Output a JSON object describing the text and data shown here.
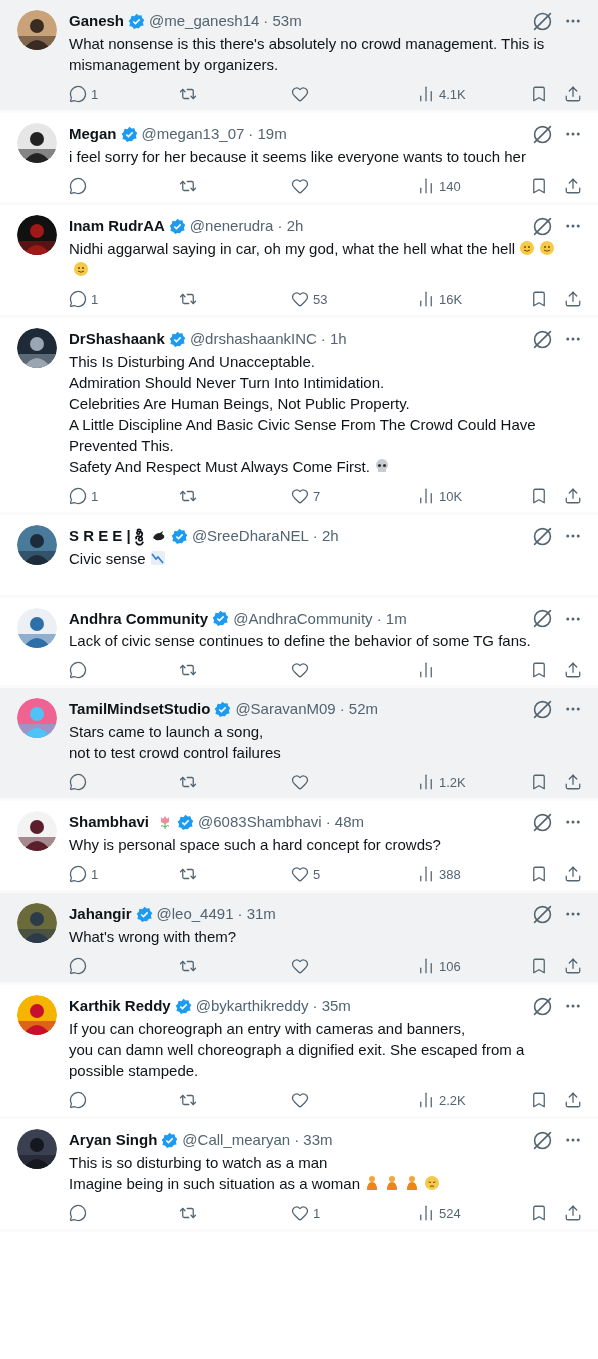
{
  "tweets": [
    {
      "name": "Ganesh",
      "handle": "@me_ganesh14",
      "time": "· 53m",
      "shaded": true,
      "text": "What nonsense is this there's absolutely no crowd management. This is mismanagement by organizers.",
      "actions": true,
      "replies": "1",
      "views": "4.1K"
    },
    {
      "name": "Megan",
      "handle": "@megan13_07",
      "time": "· 19m",
      "shaded": false,
      "text": "i feel sorry for her because it seems like everyone wants to touch her",
      "actions": true,
      "views": "140"
    },
    {
      "name": "Inam RudrAA",
      "handle": "@nenerudra",
      "time": "· 2h",
      "shaded": false,
      "text": "Nidhi aggarwal saying in car, oh my god, what the hell what the hell",
      "emojis": [
        {
          "kind": "smile"
        },
        {
          "kind": "smile"
        },
        {
          "kind": "smile"
        }
      ],
      "actions": true,
      "replies": "1",
      "likes": "53",
      "views": "16K"
    },
    {
      "name": "DrShashaank",
      "handle": "@drshashaankINC",
      "time": "· 1h",
      "shaded": false,
      "text": "This Is Disturbing And Unacceptable.\nAdmiration Should Never Turn Into Intimidation.\nCelebrities Are Human Beings, Not Public Property.\nA Little Discipline And Basic Civic Sense From The Crowd Could Have Prevented This.\nSafety And Respect Must Always Come First.",
      "emojis": [
        {
          "kind": "skull"
        }
      ],
      "actions": true,
      "replies": "1",
      "likes": "7",
      "views": "10K"
    },
    {
      "name": "S R E E | శ్రీ",
      "name_emojis": [
        {
          "kind": "bird"
        }
      ],
      "handle": "@SreeDharaNEL",
      "time": "· 2h",
      "shaded": false,
      "text": "Civic sense",
      "emojis": [
        {
          "kind": "chart-down"
        }
      ],
      "actions": false
    },
    {
      "name": "Andhra Community",
      "handle": "@AndhraCommunity",
      "time": "· 1m",
      "shaded": false,
      "text": "Lack of civic sense continues to define the behavior of some TG fans.",
      "actions": true
    },
    {
      "name": "TamilMindsetStudio",
      "handle": "@SaravanM09",
      "time": "· 52m",
      "shaded": true,
      "text": "Stars came to launch a song,\nnot to test crowd control failures",
      "actions": true,
      "views": "1.2K"
    },
    {
      "name": "Shambhavi",
      "name_emojis": [
        {
          "kind": "tulip"
        }
      ],
      "handle": "@6083Shambhavi",
      "time": "· 48m",
      "shaded": false,
      "text": "Why is personal space such a hard concept for crowds?",
      "actions": true,
      "replies": "1",
      "likes": "5",
      "views": "388"
    },
    {
      "name": "Jahangir",
      "handle": "@leo_4491",
      "time": "· 31m",
      "shaded": true,
      "text": "What's wrong with them?",
      "actions": true,
      "views": "106"
    },
    {
      "name": "Karthik Reddy",
      "handle": "@bykarthikreddy",
      "time": "· 35m",
      "shaded": false,
      "text": "If you can choreograph an entry with cameras and banners,\nyou can damn well choreograph a dignified exit. She escaped from a possible stampede.",
      "actions": true,
      "views": "2.2K"
    },
    {
      "name": "Aryan Singh",
      "handle": "@Call_mearyan",
      "time": "· 33m",
      "shaded": false,
      "text": "This is so disturbing to watch as a man\nImagine being in such situation as a woman",
      "emojis": [
        {
          "kind": "person"
        },
        {
          "kind": "person"
        },
        {
          "kind": "person"
        },
        {
          "kind": "sad"
        }
      ],
      "actions": true,
      "likes": "1",
      "views": "524"
    }
  ]
}
